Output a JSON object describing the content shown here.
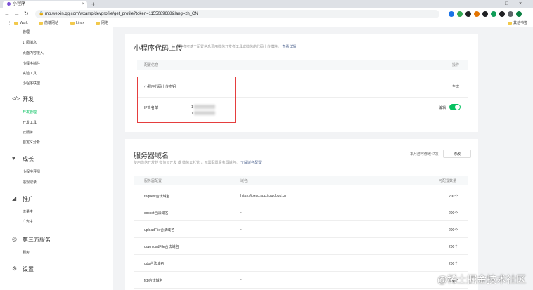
{
  "browser": {
    "tab_title": "小程序",
    "tab_close": "×",
    "new_tab": "+",
    "window_controls": [
      "—",
      "□",
      "×"
    ],
    "url": "mp.weixin.qq.com/wxamp/devprofile/get_profile?token=1155089688&lang=zh_CN",
    "bookmarks": [
      "Work",
      "前端网站",
      "Linux",
      "网络"
    ],
    "other_bookmarks": "其他书签",
    "extension_colors": [
      "#1a73e8",
      "#34a853",
      "#202124",
      "#e37400",
      "#202124",
      "#0f9d58",
      "#202124",
      "#5f6368",
      "#0b8043"
    ]
  },
  "sidebar": {
    "top_items": [
      "管理",
      "订阅消息",
      "页面内容接入",
      "小程序插件",
      "实验工具",
      "小程序联盟"
    ],
    "groups": [
      {
        "icon": "code-icon",
        "glyph": "</>",
        "label": "开发",
        "items": [
          "开发管理",
          "开发工具",
          "云服务",
          "自定义分析"
        ],
        "active": "开发管理"
      },
      {
        "icon": "growth-icon",
        "glyph": "♥",
        "label": "成长",
        "items": [
          "小程序评测",
          "违规记录"
        ]
      },
      {
        "icon": "promotion-icon",
        "glyph": "◢",
        "label": "推广",
        "items": [
          "流量主",
          "广告主"
        ]
      },
      {
        "icon": "third-party-icon",
        "glyph": "◎",
        "label": "第三方服务",
        "items": [
          "服务"
        ]
      },
      {
        "icon": "settings-icon",
        "glyph": "⚙",
        "label": "设置",
        "items": []
      }
    ]
  },
  "upload_section": {
    "title": "小程序代码上传",
    "description": "开发者可基于配置信息调用微信开发者工具或微信的代码上传模块。",
    "description_link": "查看详情",
    "columns": [
      "配置信息",
      "操作"
    ],
    "row1_label": "小程序代码上传密钥",
    "row1_action": "生成",
    "row2_label": "IP白名单",
    "row2_ips": [
      "1",
      "1"
    ],
    "row2_action": "编辑"
  },
  "server_section": {
    "title": "服务器域名",
    "description_prefix": "使用微信开发的 微信云开发 或 微信云托管 ，无需配置服务器域名。",
    "description_link": "了解域名配置",
    "quota_text": "本月还可修改47次",
    "modify_button": "修改",
    "columns": [
      "服务器配置",
      "域名",
      "可配置数量"
    ],
    "rows": [
      {
        "name": "request合法域名",
        "domain": "https://joesu.app.tcrgcloud.cn",
        "count": "200个"
      },
      {
        "name": "socket合法域名",
        "domain": "-",
        "count": "200个"
      },
      {
        "name": "uploadFile合法域名",
        "domain": "-",
        "count": "200个"
      },
      {
        "name": "downloadFile合法域名",
        "domain": "-",
        "count": "200个"
      },
      {
        "name": "udp合法域名",
        "domain": "-",
        "count": "200个"
      },
      {
        "name": "tcp合法域名",
        "domain": "-",
        "count": "200个"
      }
    ]
  },
  "watermark": "@稀土掘金技术社区"
}
